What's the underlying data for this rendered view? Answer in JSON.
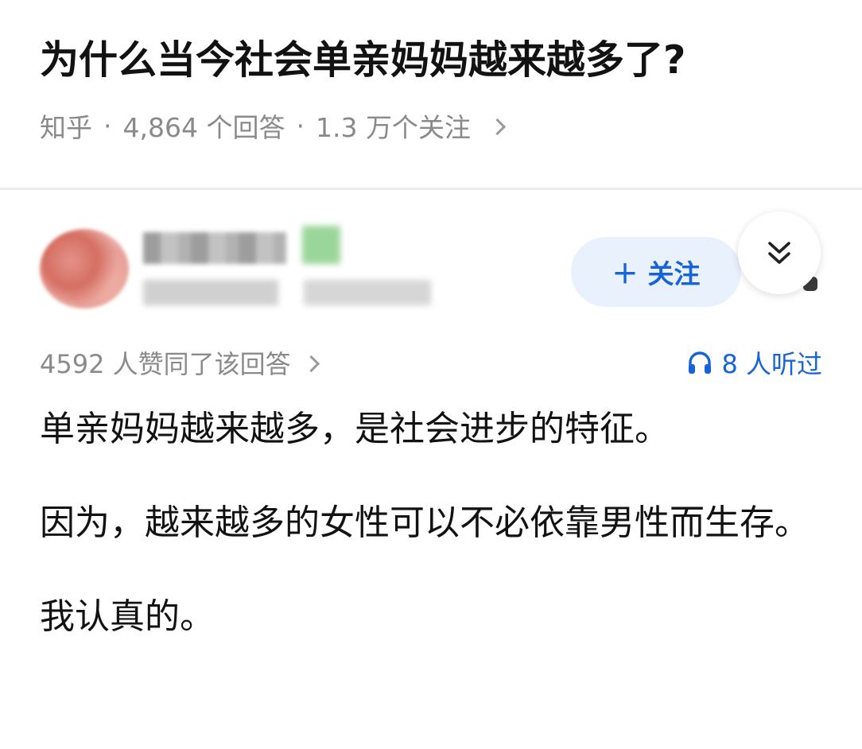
{
  "question": {
    "title": "为什么当今社会单亲妈妈越来越多了?",
    "source": "知乎",
    "separator": "·",
    "answer_count": "4,864 个回答",
    "follower_count": "1.3 万个关注"
  },
  "author": {
    "follow_label": "关注"
  },
  "answer": {
    "vote_text": "4592 人赞同了该回答",
    "listen_text": "8 人听过",
    "paragraphs": [
      "单亲妈妈越来越多，是社会进步的特征。",
      "因为，越来越多的女性可以不必依靠男性而生存。",
      "我认真的。"
    ]
  },
  "colors": {
    "accent": "#1764d8",
    "follow_bg": "#e9f1fd",
    "meta_gray": "#8a8a8a",
    "divider": "#ebebeb"
  },
  "icons": {
    "collapse": "double-chevron-down-icon",
    "listen": "headphones-icon",
    "follow": "plus-icon"
  }
}
